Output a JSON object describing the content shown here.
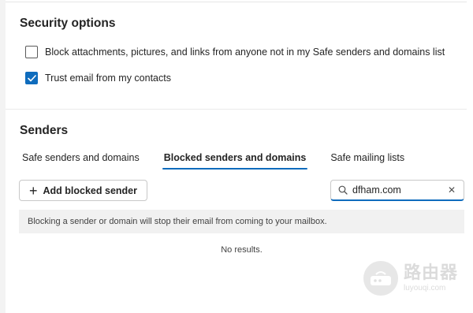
{
  "security": {
    "title": "Security options",
    "options": [
      {
        "label": "Block attachments, pictures, and links from anyone not in my Safe senders and domains list",
        "checked": false
      },
      {
        "label": "Trust email from my contacts",
        "checked": true
      }
    ]
  },
  "senders": {
    "title": "Senders",
    "tabs": [
      {
        "label": "Safe senders and domains",
        "active": false
      },
      {
        "label": "Blocked senders and domains",
        "active": true
      },
      {
        "label": "Safe mailing lists",
        "active": false
      }
    ],
    "add_button_label": "Add blocked sender",
    "search": {
      "value": "dfham.com"
    },
    "info_text": "Blocking a sender or domain will stop their email from coming to your mailbox.",
    "no_results": "No results."
  },
  "watermark": {
    "cn": "路由器",
    "en": "luyouqi.com"
  },
  "colors": {
    "accent": "#0f6cbd",
    "info_bg": "#f1f1f1"
  },
  "icons": [
    "checkbox-checked-icon",
    "plus-icon",
    "search-icon",
    "close-icon",
    "router-logo-icon"
  ]
}
